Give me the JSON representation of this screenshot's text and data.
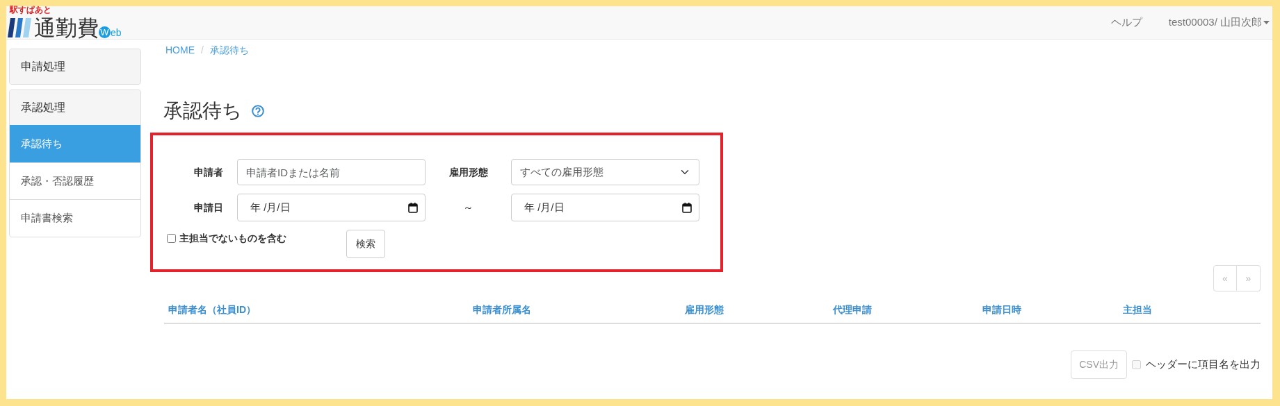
{
  "logo": {
    "tagline": "駅すぱあと",
    "title": "通勤費",
    "web_initial": "W",
    "web_rest": "eb"
  },
  "navbar": {
    "links": [
      {
        "label": "ヘルプ",
        "kind": "link"
      },
      {
        "label": "test00003/ 山田次郎",
        "kind": "dropdown"
      }
    ]
  },
  "sidebar": {
    "groups": [
      {
        "title": "申請処理"
      },
      {
        "title": "承認処理",
        "items": [
          {
            "label": "承認待ち",
            "selected": true
          },
          {
            "label": "承認・否認履歴",
            "selected": false
          },
          {
            "label": "申請書検索",
            "selected": false
          }
        ]
      }
    ]
  },
  "breadcrumb": [
    {
      "label": "HOME"
    },
    {
      "label": "承認待ち"
    }
  ],
  "breadcrumb_separator": "/",
  "page_title": "承認待ち",
  "search_form": {
    "highlighted": true,
    "applicant_label": "申請者",
    "applicant_placeholder": "申請者IDまたは名前",
    "employment_label": "雇用形態",
    "employment_value": "すべての雇用形態",
    "date_label": "申請日",
    "date_from": "年 /月/日",
    "range_separator": "～",
    "date_to": "年 /月/日",
    "include_non_primary": {
      "label": "主担当でないものを含む",
      "checked": false
    },
    "search_button": "検索"
  },
  "pagination": [
    {
      "label": "«",
      "disabled": true
    },
    {
      "label": "»",
      "disabled": true
    }
  ],
  "table": {
    "columns": [
      "申請者名（社員ID）",
      "申請者所属名",
      "雇用形態",
      "代理申請",
      "申請日時",
      "主担当"
    ]
  },
  "footer": {
    "csv_button": {
      "label": "CSV出力",
      "disabled": true
    },
    "header_option": {
      "label": "ヘッダーに項目名を出力",
      "checked": false,
      "disabled": true
    }
  }
}
